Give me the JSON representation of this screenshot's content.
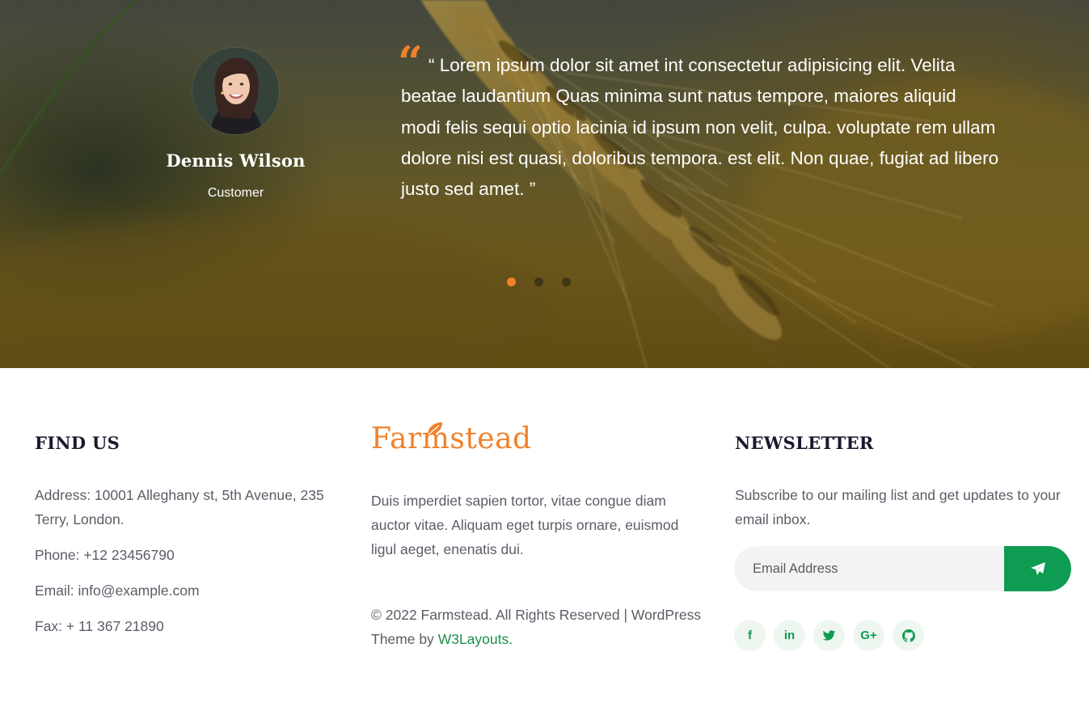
{
  "testimonial": {
    "name": "Dennis Wilson",
    "role": "Customer",
    "quote_icon": "“",
    "quote": "“ Lorem ipsum dolor sit amet int consectetur adipisicing elit. Velita beatae laudantium Quas minima sunt natus tempore, maiores aliquid modi felis sequi optio lacinia id ipsum non velit, culpa. voluptate rem ullam dolore nisi est quasi, doloribus tempora. est elit. Non quae, fugiat ad libero justo sed amet. ”",
    "slides": 3,
    "active_slide": 1
  },
  "find_us": {
    "heading": "FIND US",
    "address": "Address: 10001 Alleghany st, 5th Avenue, 235 Terry, London.",
    "phone": "Phone: +12 23456790",
    "email": "Email: info@example.com",
    "fax": "Fax: + 11 367 21890"
  },
  "brand": {
    "logo": "Farmstead",
    "description": "Duis imperdiet sapien tortor, vitae congue diam auctor vitae. Aliquam eget turpis ornare, euismod ligul aeget, enenatis dui.",
    "copyright": "© 2022 Farmstead. All Rights Reserved | WordPress Theme by ",
    "credit_link": "W3Layouts."
  },
  "newsletter": {
    "heading": "NEWSLETTER",
    "description": "Subscribe to our mailing list and get updates to your email inbox.",
    "email_placeholder": "Email Address",
    "submit_icon": "paper-plane-icon"
  },
  "socials": [
    {
      "icon": "facebook-icon",
      "glyph": "f"
    },
    {
      "icon": "linkedin-icon",
      "glyph": "in"
    },
    {
      "icon": "twitter-icon",
      "glyph": ""
    },
    {
      "icon": "google-plus-icon",
      "glyph": "G+"
    },
    {
      "icon": "github-icon",
      "glyph": ""
    }
  ],
  "colors": {
    "accent_orange": "#f0812a",
    "accent_green": "#0e9b52",
    "heading": "#1a1a2e",
    "body_text": "#5c5c68"
  }
}
